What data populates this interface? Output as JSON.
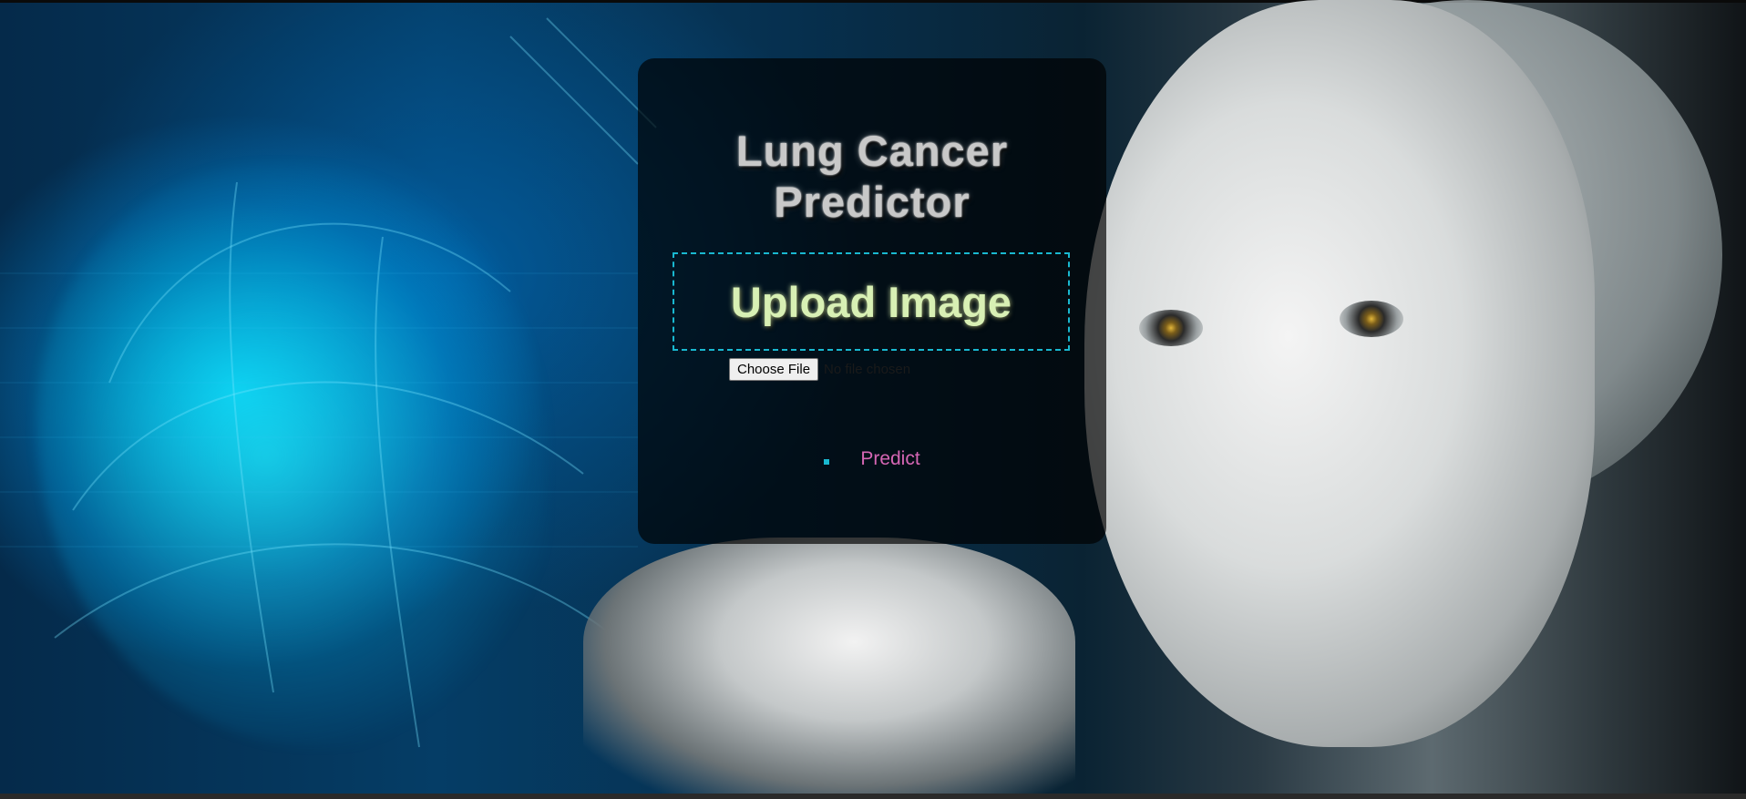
{
  "card": {
    "title": "Lung Cancer Predictor",
    "upload_label": "Upload Image",
    "file_button_label": "Choose File",
    "file_status": "No file chosen",
    "predict_label": "Predict"
  },
  "colors": {
    "card_background": "#000000",
    "upload_border": "#19b8d0",
    "upload_text": "#d8f0b4",
    "predict_link": "#d566b4",
    "title_text": "#c8c8c8"
  },
  "icons": {
    "list_bullet": "square-bullet-icon"
  }
}
